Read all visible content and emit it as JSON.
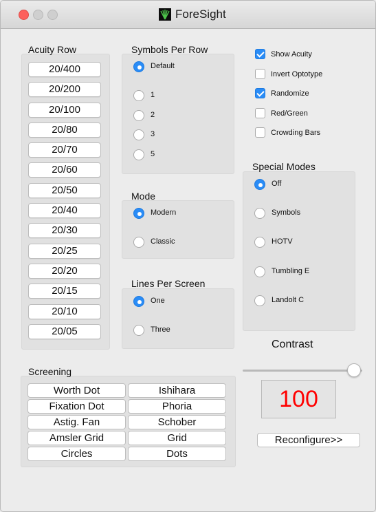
{
  "window": {
    "title": "ForeSight"
  },
  "acuity": {
    "label": "Acuity Row",
    "rows": [
      "20/400",
      "20/200",
      "20/100",
      "20/80",
      "20/70",
      "20/60",
      "20/50",
      "20/40",
      "20/30",
      "20/25",
      "20/20",
      "20/15",
      "20/10",
      "20/05"
    ]
  },
  "symbols_per_row": {
    "label": "Symbols Per Row",
    "options": [
      {
        "label": "Default",
        "selected": true
      },
      {
        "label": "1",
        "selected": false
      },
      {
        "label": "2",
        "selected": false
      },
      {
        "label": "3",
        "selected": false
      },
      {
        "label": "5",
        "selected": false
      }
    ]
  },
  "mode": {
    "label": "Mode",
    "options": [
      {
        "label": "Modern",
        "selected": true
      },
      {
        "label": "Classic",
        "selected": false
      }
    ]
  },
  "lines_per_screen": {
    "label": "Lines Per Screen",
    "options": [
      {
        "label": "One",
        "selected": true
      },
      {
        "label": "Three",
        "selected": false
      }
    ]
  },
  "options": [
    {
      "label": "Show Acuity",
      "checked": true
    },
    {
      "label": "Invert Optotype",
      "checked": false
    },
    {
      "label": "Randomize",
      "checked": true
    },
    {
      "label": "Red/Green",
      "checked": false
    },
    {
      "label": "Crowding Bars",
      "checked": false
    }
  ],
  "special_modes": {
    "label": "Special Modes",
    "options": [
      {
        "label": "Off",
        "selected": true
      },
      {
        "label": "Symbols",
        "selected": false
      },
      {
        "label": "HOTV",
        "selected": false
      },
      {
        "label": "Tumbling E",
        "selected": false
      },
      {
        "label": "Landolt C",
        "selected": false
      }
    ]
  },
  "contrast": {
    "label": "Contrast",
    "value": "100",
    "level": 1.0
  },
  "reconfigure_label": "Reconfigure>>",
  "screening": {
    "label": "Screening",
    "left": [
      "Worth Dot",
      "Fixation Dot",
      "Astig. Fan",
      "Amsler Grid",
      "Circles"
    ],
    "right": [
      "Ishihara",
      "Phoria",
      "Schober",
      "Grid",
      "Dots"
    ]
  },
  "colors": {
    "accent": "#2a8cf6",
    "contrast_value": "#ff0000",
    "panel": "#e1e1e1"
  }
}
